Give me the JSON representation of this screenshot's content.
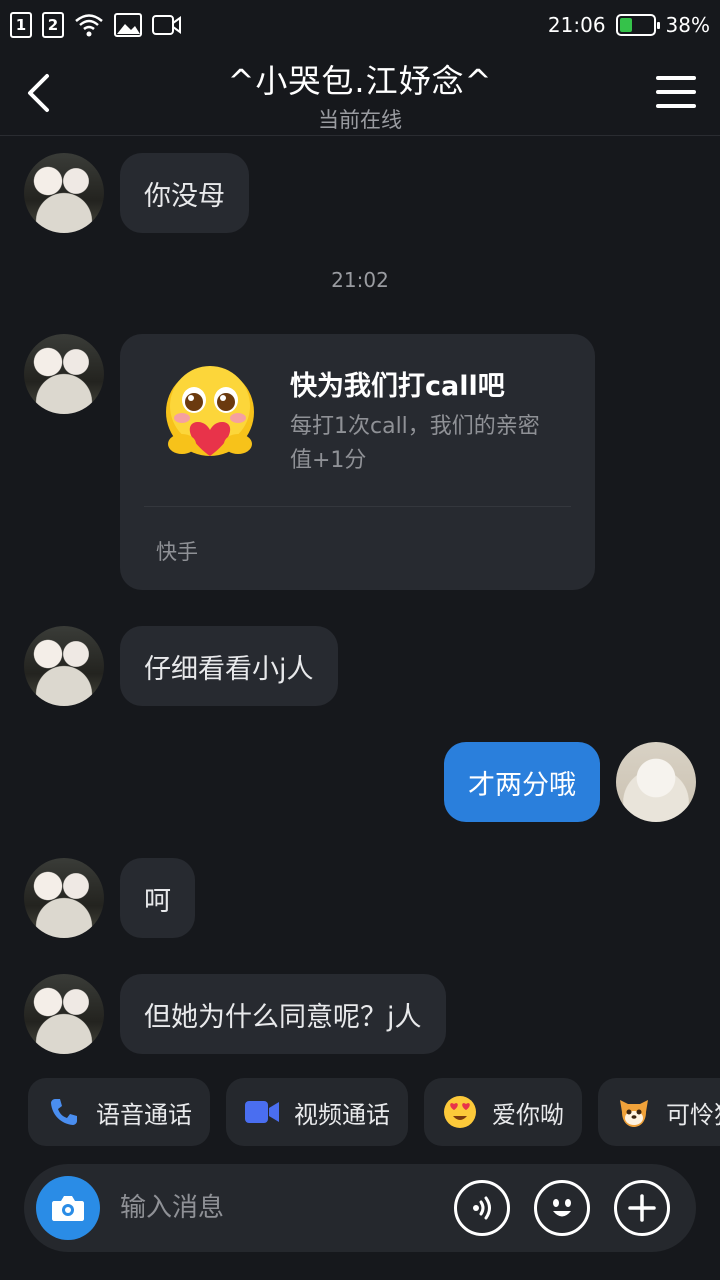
{
  "status_bar": {
    "sim1": "1",
    "sim2": "2",
    "time": "21:06",
    "battery_percent": "38%",
    "battery_level": 0.38
  },
  "header": {
    "title": "^小哭包.江妤念^",
    "subtitle": "当前在线"
  },
  "messages": [
    {
      "side": "left",
      "text": "你没母"
    },
    {
      "timestamp": "21:02"
    },
    {
      "side": "left",
      "card": {
        "title": "快为我们打call吧",
        "description": "每打1次call，我们的亲密值+1分",
        "source": "快手",
        "emoji": "hugging-heart-emoji"
      }
    },
    {
      "side": "left",
      "text": "仔细看看小j人"
    },
    {
      "side": "right",
      "text": "才两分哦"
    },
    {
      "side": "left",
      "text": "呵"
    },
    {
      "side": "left",
      "text": "但她为什么同意呢？j人"
    }
  ],
  "quick_actions": [
    {
      "label": "语音通话",
      "icon": "phone-icon",
      "color": "#4a8ef0"
    },
    {
      "label": "视频通话",
      "icon": "video-camera-icon",
      "color": "#4a6ef0"
    },
    {
      "label": "爱你呦",
      "icon": "heart-eyes-emoji"
    },
    {
      "label": "可怜狗",
      "icon": "dog-emoji"
    }
  ],
  "input": {
    "placeholder": "输入消息"
  },
  "colors": {
    "background": "#16181c",
    "bubble_received": "#272a30",
    "bubble_sent": "#2a7fdc",
    "accent": "#2a8ce6"
  }
}
